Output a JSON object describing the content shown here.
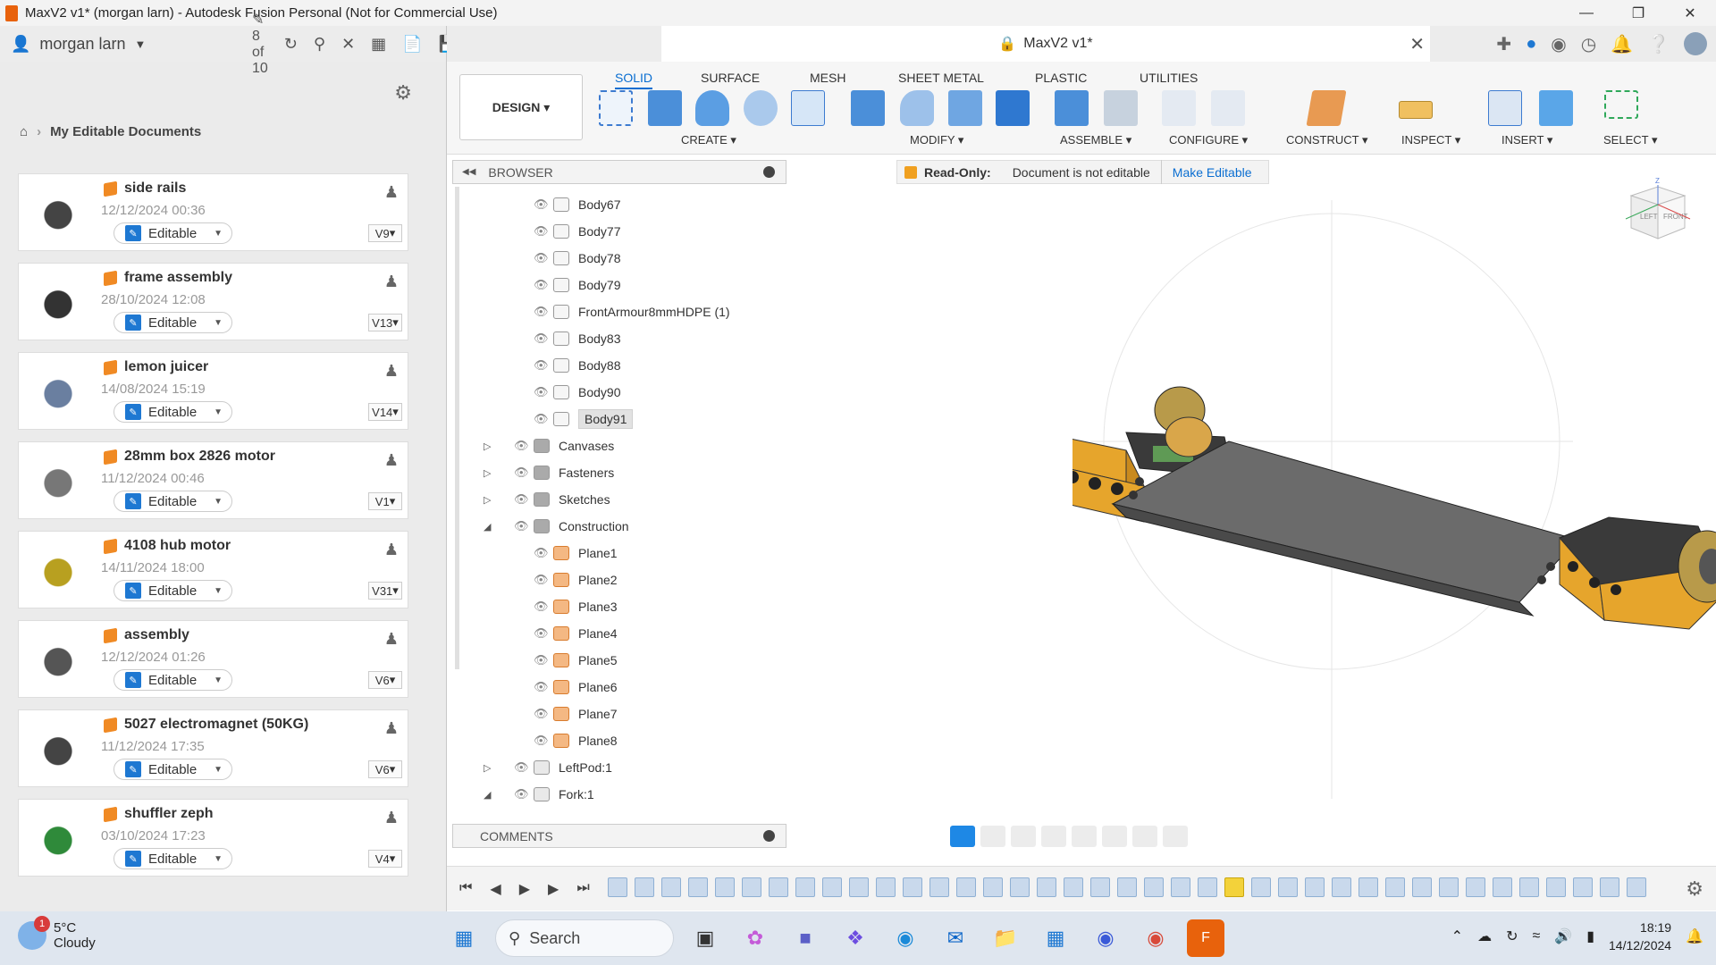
{
  "window": {
    "title": "MaxV2 v1* (morgan larn) - Autodesk Fusion Personal (Not for Commercial Use)",
    "min_icon": "minimize-icon",
    "max_icon": "restore-icon",
    "close_icon": "close-icon"
  },
  "left_panel": {
    "user_name": "morgan larn",
    "job_count": "8 of 10",
    "breadcrumb": "My Editable Documents",
    "documents": [
      {
        "name": "side rails",
        "date": "12/12/2024 00:36",
        "status": "Editable",
        "version": "V9"
      },
      {
        "name": "frame assembly",
        "date": "28/10/2024 12:08",
        "status": "Editable",
        "version": "V13"
      },
      {
        "name": "lemon juicer",
        "date": "14/08/2024 15:19",
        "status": "Editable",
        "version": "V14"
      },
      {
        "name": "28mm box 2826 motor",
        "date": "11/12/2024 00:46",
        "status": "Editable",
        "version": "V1"
      },
      {
        "name": "4108 hub motor",
        "date": "14/11/2024 18:00",
        "status": "Editable",
        "version": "V31"
      },
      {
        "name": "assembly",
        "date": "12/12/2024 01:26",
        "status": "Editable",
        "version": "V6"
      },
      {
        "name": "5027 electromagnet (50KG)",
        "date": "11/12/2024 17:35",
        "status": "Editable",
        "version": "V6"
      },
      {
        "name": "shuffler zeph",
        "date": "03/10/2024 17:23",
        "status": "Editable",
        "version": "V4"
      }
    ]
  },
  "doc_tab": {
    "title": "MaxV2 v1*"
  },
  "ribbon": {
    "workspace": "DESIGN ▾",
    "tabs": [
      "SOLID",
      "SURFACE",
      "MESH",
      "SHEET METAL",
      "PLASTIC",
      "UTILITIES"
    ],
    "groups": [
      "CREATE ▾",
      "MODIFY ▾",
      "ASSEMBLE ▾",
      "CONFIGURE ▾",
      "CONSTRUCT ▾",
      "INSPECT ▾",
      "INSERT ▾",
      "SELECT ▾"
    ]
  },
  "browser": {
    "title": "BROWSER",
    "bodies": [
      "Body67",
      "Body77",
      "Body78",
      "Body79",
      "FrontArmour8mmHDPE (1)",
      "Body83",
      "Body88",
      "Body90",
      "Body91"
    ],
    "folders": [
      "Canvases",
      "Fasteners",
      "Sketches",
      "Construction"
    ],
    "planes": [
      "Plane1",
      "Plane2",
      "Plane3",
      "Plane4",
      "Plane5",
      "Plane6",
      "Plane7",
      "Plane8"
    ],
    "components": [
      "LeftPod:1",
      "Fork:1"
    ]
  },
  "readonly": {
    "label": "Read-Only:",
    "message": "Document is not editable",
    "action": "Make Editable"
  },
  "comments": {
    "title": "COMMENTS"
  },
  "viewcube": {
    "left": "LEFT",
    "front": "FRONT",
    "axis_z": "Z"
  },
  "taskbar": {
    "temp": "5°C",
    "condition": "Cloudy",
    "weather_badge": "1",
    "search": "Search",
    "time": "18:19",
    "date": "14/12/2024"
  },
  "colors": {
    "accent": "#0a6ed1",
    "body_orange": "#e6a52c",
    "plate_gray": "#6b6b6b"
  }
}
